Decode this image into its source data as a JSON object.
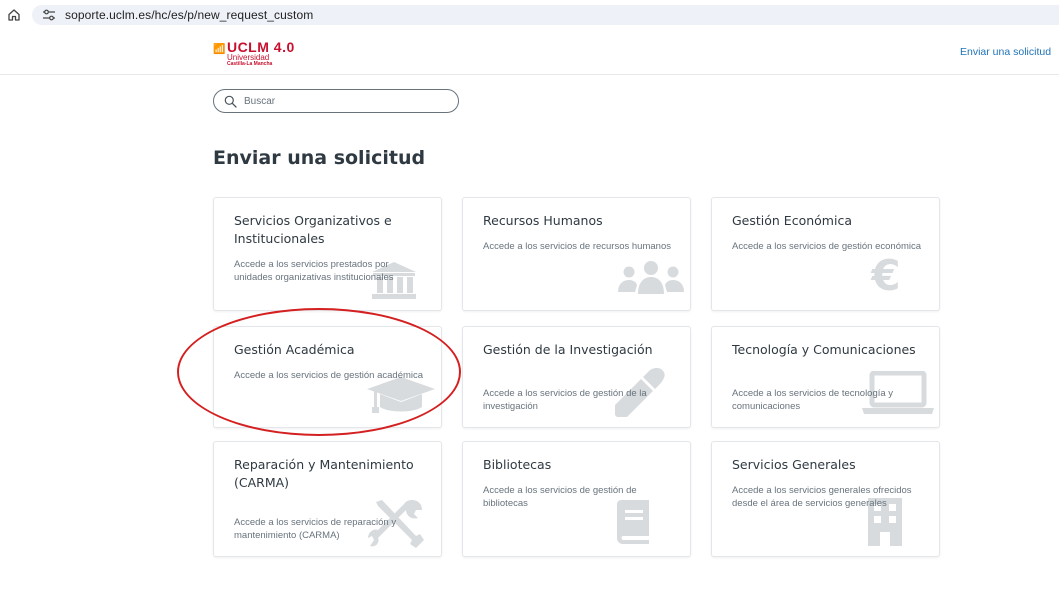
{
  "browser": {
    "url": "soporte.uclm.es/hc/es/p/new_request_custom"
  },
  "header": {
    "logo": {
      "wordmark": "UCLM 4.0",
      "line1": "Universidad",
      "line2": "Castilla-La Mancha"
    },
    "submit_link": "Enviar una solicitud"
  },
  "search": {
    "placeholder": "Buscar"
  },
  "page_title": "Enviar una solicitud",
  "cards": [
    {
      "title": "Servicios Organizativos e Institucionales",
      "description": "Accede a los servicios prestados por unidades organizativas institucionales",
      "icon": "institution-icon"
    },
    {
      "title": "Recursos Humanos",
      "description": "Accede a los servicios de recursos humanos",
      "icon": "people-icon"
    },
    {
      "title": "Gestión Económica",
      "description": "Accede a los servicios de gestión económica",
      "icon": "euro-icon"
    },
    {
      "title": "Gestión Académica",
      "description": "Accede a los servicios de gestión académica",
      "icon": "graduation-cap-icon"
    },
    {
      "title": "Gestión de la Investigación",
      "description": "Accede a los servicios de gestión de la investigación",
      "icon": "eyedropper-icon"
    },
    {
      "title": "Tecnología y Comunicaciones",
      "description": "Accede a los servicios de tecnología y comunicaciones",
      "icon": "laptop-icon"
    },
    {
      "title": "Reparación y Mantenimiento (CARMA)",
      "description": "Accede a los servicios de reparación y mantenimiento (CARMA)",
      "icon": "tools-icon"
    },
    {
      "title": "Bibliotecas",
      "description": "Accede a los servicios de gestión de bibliotecas",
      "icon": "book-icon"
    },
    {
      "title": "Servicios Generales",
      "description": "Accede a los servicios generales ofrecidos desde el área de servicios generales",
      "icon": "building-icon"
    }
  ],
  "colors": {
    "brand_red": "#c8102e",
    "link_blue": "#1f73b7",
    "annotation_red": "#d42020"
  }
}
